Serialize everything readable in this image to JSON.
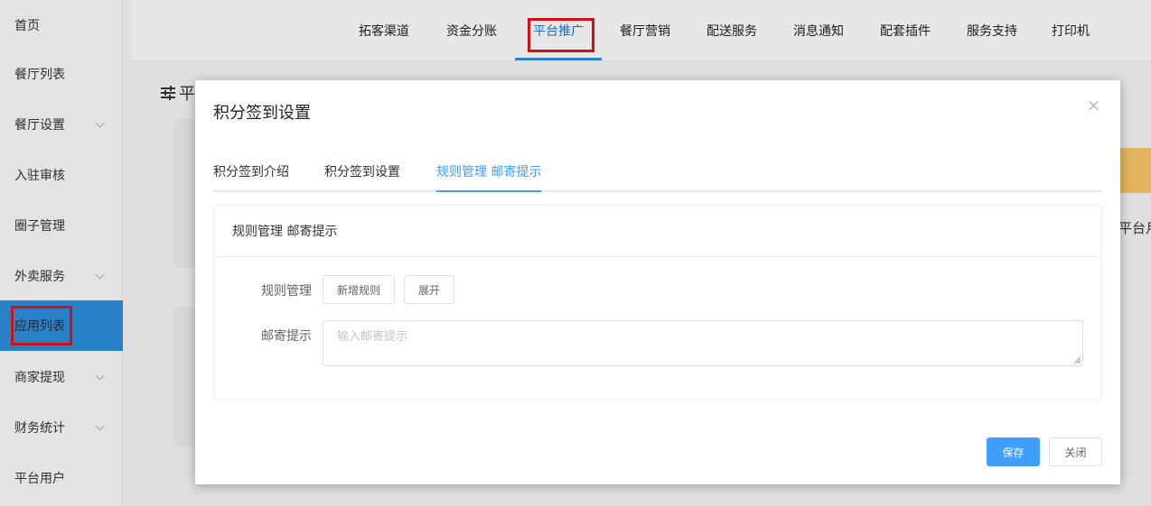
{
  "sidebar": {
    "items": [
      {
        "label": "首页",
        "has_chevron": false
      },
      {
        "label": "餐厅列表",
        "has_chevron": false
      },
      {
        "label": "餐厅设置",
        "has_chevron": true
      },
      {
        "label": "入驻审核",
        "has_chevron": false
      },
      {
        "label": "圈子管理",
        "has_chevron": false
      },
      {
        "label": "外卖服务",
        "has_chevron": true
      },
      {
        "label": "应用列表",
        "has_chevron": false,
        "active": true
      },
      {
        "label": "商家提现",
        "has_chevron": true
      },
      {
        "label": "财务统计",
        "has_chevron": true
      },
      {
        "label": "平台用户",
        "has_chevron": false
      }
    ]
  },
  "topnav": {
    "items": [
      "拓客渠道",
      "资金分账",
      "平台推广",
      "餐厅营销",
      "配送服务",
      "消息通知",
      "配套插件",
      "服务支持",
      "打印机"
    ],
    "active": "平台推广"
  },
  "background": {
    "title_partial": "平",
    "right_text_partial": "平台月"
  },
  "modal": {
    "title": "积分签到设置",
    "tabs": [
      "积分签到介绍",
      "积分签到设置",
      "规则管理 邮寄提示"
    ],
    "active_tab": "规则管理 邮寄提示",
    "panel": {
      "header": "规则管理 邮寄提示",
      "rule_label": "规则管理",
      "add_rule_button": "新增规则",
      "expand_button": "展开",
      "mail_label": "邮寄提示",
      "mail_placeholder": "输入邮寄提示"
    },
    "save_button": "保存",
    "close_button": "关闭"
  },
  "colors": {
    "accent": "#409eff",
    "sidebar_active": "#2d8cd8",
    "highlight_box": "#e0141c"
  }
}
